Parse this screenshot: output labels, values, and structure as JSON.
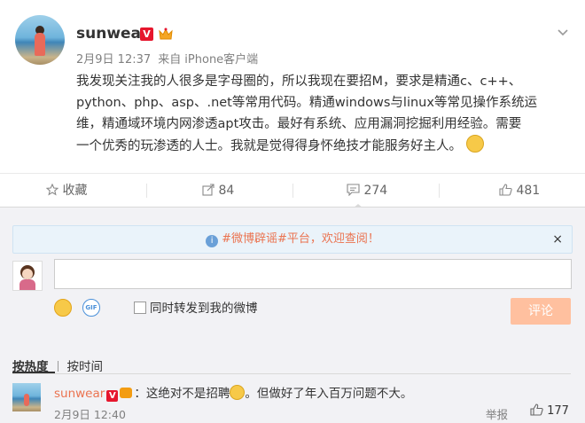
{
  "post": {
    "username": "sunwear",
    "verified_badge": "V",
    "time": "2月9日 12:37",
    "source_prefix": "来自",
    "source": "iPhone客户端",
    "more_icon": "chevron-down-icon",
    "content_lines": [
      "我发现关注我的人很多是字母圈的，所以我现在要招M，要求是精通c、c++、",
      "python、php、asp、.net等常用代码。精通windows与linux等常见操作系统运",
      "维，精通域环境内网渗透apt攻击。最好有系统、应用漏洞挖掘利用经验。需要",
      "一个优秀的玩渗透的人士。我就是觉得得身怀绝技才能服务好主人。"
    ]
  },
  "actions": {
    "favorite": "收藏",
    "repost": "84",
    "comment": "274",
    "like": "481"
  },
  "comment_box": {
    "notice": "#微博辟谣#平台，欢迎查阅！",
    "close": "×",
    "placeholder": "",
    "also_repost": "同时转发到我的微博",
    "submit": "评论"
  },
  "sort": {
    "by_heat": "按热度",
    "by_time": "按时间"
  },
  "comments": [
    {
      "user": "sunwear",
      "text_a": "：这绝对不是招聘",
      "text_b": "。但做好了年入百万问题不大。",
      "time": "2月9日 12:40",
      "report": "举报",
      "likes": "177"
    }
  ],
  "colors": {
    "accent": "#eb7350",
    "submit_disabled": "#ffc09f",
    "notice_bg": "#eaf3fa",
    "verified": "#e6162d"
  }
}
